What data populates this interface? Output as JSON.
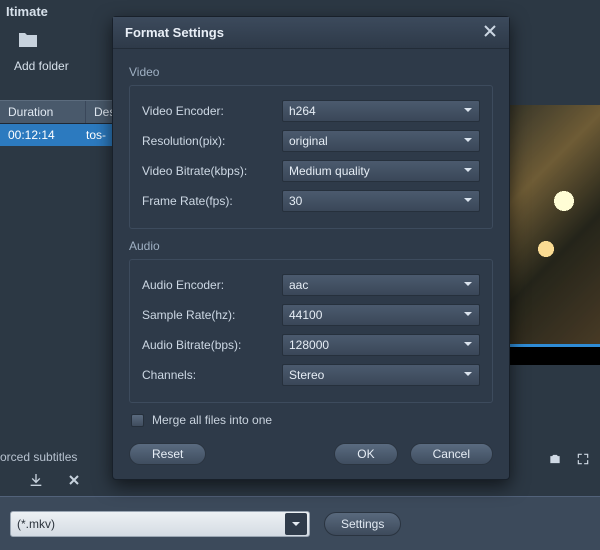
{
  "app": {
    "title_fragment": "Itimate"
  },
  "toolbar": {
    "add_folder": "Add folder"
  },
  "list": {
    "header": {
      "duration": "Duration",
      "destination": "Dest"
    },
    "rows": [
      {
        "duration": "00:12:14",
        "destination": "tos-"
      }
    ]
  },
  "subtitle_label": "orced subtitles",
  "bottom": {
    "format_value": "(*.mkv)",
    "settings_button": "Settings"
  },
  "modal": {
    "title": "Format Settings",
    "video": {
      "section": "Video",
      "encoder_label": "Video Encoder:",
      "encoder_value": "h264",
      "resolution_label": "Resolution(pix):",
      "resolution_value": "original",
      "bitrate_label": "Video Bitrate(kbps):",
      "bitrate_value": "Medium quality",
      "framerate_label": "Frame Rate(fps):",
      "framerate_value": "30"
    },
    "audio": {
      "section": "Audio",
      "encoder_label": "Audio Encoder:",
      "encoder_value": "aac",
      "samplerate_label": "Sample Rate(hz):",
      "samplerate_value": "44100",
      "bitrate_label": "Audio Bitrate(bps):",
      "bitrate_value": "128000",
      "channels_label": "Channels:",
      "channels_value": "Stereo"
    },
    "merge_label": "Merge all files into one",
    "buttons": {
      "reset": "Reset",
      "ok": "OK",
      "cancel": "Cancel"
    }
  }
}
